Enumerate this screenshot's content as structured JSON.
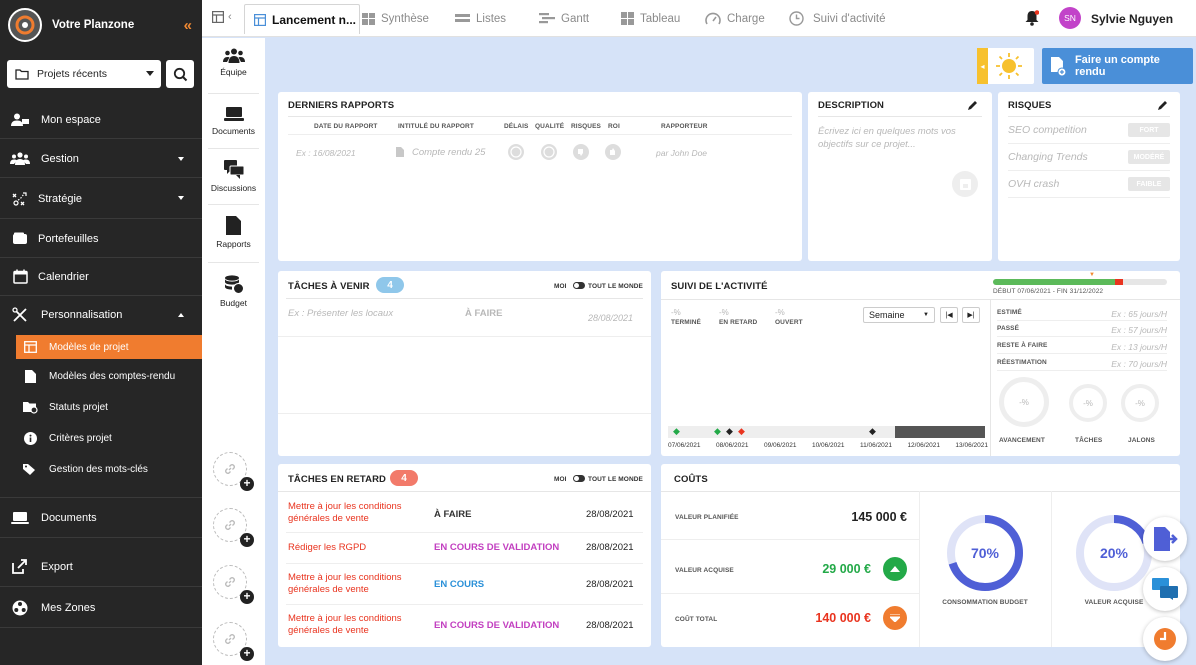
{
  "sidebar": {
    "app_title": "Votre Planzone",
    "project_selector": "Projets récents",
    "items": [
      {
        "label": "Mon espace",
        "icon": "users-icon"
      },
      {
        "label": "Gestion",
        "icon": "team-icon"
      },
      {
        "label": "Stratégie",
        "icon": "strategy-icon"
      },
      {
        "label": "Portefeuilles",
        "icon": "wallet-icon"
      },
      {
        "label": "Calendrier",
        "icon": "calendar-icon"
      },
      {
        "label": "Personnalisation",
        "icon": "tools-icon"
      },
      {
        "label": "Documents",
        "icon": "laptop-icon"
      },
      {
        "label": "Export",
        "icon": "export-icon"
      },
      {
        "label": "Mes Zones",
        "icon": "zones-icon"
      }
    ],
    "sub_items": [
      {
        "label": "Modèles de projet"
      },
      {
        "label": "Modèles des comptes-rendu"
      },
      {
        "label": "Statuts projet"
      },
      {
        "label": "Critères projet"
      },
      {
        "label": "Gestion des mots-clés"
      }
    ]
  },
  "topbar": {
    "active_tab": "Lancement n...",
    "tabs": [
      "Synthèse",
      "Listes",
      "Gantt",
      "Tableau",
      "Charge",
      "Suivi d'activité"
    ],
    "user_initials": "SN",
    "user_name": "Sylvie Nguyen"
  },
  "rail": {
    "items": [
      "Équipe",
      "Documents",
      "Discussions",
      "Rapports",
      "Budget"
    ]
  },
  "report_button": "Faire un compte rendu",
  "reports": {
    "title": "DERNIERS RAPPORTS",
    "columns": [
      "DATE DU RAPPORT",
      "INTITULÉ DU RAPPORT",
      "DÉLAIS",
      "QUALITÉ",
      "RISQUES",
      "ROI",
      "RAPPORTEUR"
    ],
    "example_date": "Ex : 16/08/2021",
    "example_title": "Compte rendu 25",
    "example_author": "par John Doe"
  },
  "description": {
    "title": "DESCRIPTION",
    "placeholder": "Écrivez ici en quelques mots vos objectifs sur ce projet..."
  },
  "risks": {
    "title": "RISQUES",
    "items": [
      {
        "name": "SEO competition",
        "level": "FORT"
      },
      {
        "name": "Changing Trends",
        "level": "MODÉRÉ"
      },
      {
        "name": "OVH crash",
        "level": "FAIBLE"
      }
    ]
  },
  "upcoming": {
    "title": "TÂCHES À VENIR",
    "count": "4",
    "toggle_me": "MOI",
    "toggle_all": "TOUT LE MONDE",
    "example_task": "Ex : Présenter les locaux",
    "example_status": "À FAIRE",
    "example_date": "28/08/2021"
  },
  "activity": {
    "title": "SUIVI DE L'ACTIVITÉ",
    "date_range": "DÉBUT 07/06/2021 - FIN 31/12/2022",
    "progress_green": 0.7,
    "progress_red": 0.05,
    "stats": [
      {
        "value": "-%",
        "label": "TERMINÉ"
      },
      {
        "value": "-%",
        "label": "EN RETARD"
      },
      {
        "value": "-%",
        "label": "OUVERT"
      }
    ],
    "period": "Semaine",
    "timeline_dates": [
      "07/06/2021",
      "08/06/2021",
      "09/06/2021",
      "10/06/2021",
      "11/06/2021",
      "12/06/2021",
      "13/06/2021"
    ],
    "metrics": [
      {
        "label": "ESTIMÉ",
        "value": "Ex : 65 jours/H"
      },
      {
        "label": "PASSÉ",
        "value": "Ex : 57 jours/H"
      },
      {
        "label": "RESTE À FAIRE",
        "value": "Ex : 13 jours/H"
      },
      {
        "label": "RÉESTIMATION",
        "value": "Ex : 70 jours/H"
      }
    ],
    "gauges": [
      {
        "value": "-%",
        "label": "AVANCEMENT"
      },
      {
        "value": "-%",
        "label": "TÂCHES"
      },
      {
        "value": "-%",
        "label": "JALONS"
      }
    ]
  },
  "late": {
    "title": "TÂCHES EN RETARD",
    "count": "4",
    "toggle_me": "MOI",
    "toggle_all": "TOUT LE MONDE",
    "rows": [
      {
        "task": "Mettre à jour les conditions générales de vente",
        "status": "À FAIRE",
        "status_color": "#333333",
        "date": "28/08/2021"
      },
      {
        "task": "Rédiger les RGPD",
        "status": "EN COURS DE VALIDATION",
        "status_color": "#c23fc0",
        "date": "28/08/2021"
      },
      {
        "task": "Mettre à jour les conditions générales de vente",
        "status": "EN COURS",
        "status_color": "#2a90d8",
        "date": "28/08/2021"
      },
      {
        "task": "Mettre à jour les conditions générales de vente",
        "status": "EN COURS DE VALIDATION",
        "status_color": "#c23fc0",
        "date": "28/08/2021"
      }
    ]
  },
  "costs": {
    "title": "COÛTS",
    "planned_label": "VALEUR PLANIFIÉE",
    "planned_value": "145 000 €",
    "acquired_label": "VALEUR ACQUISE",
    "acquired_value": "29 000 €",
    "total_label": "COÛT TOTAL",
    "total_value": "140 000 €",
    "budget_pct": "70%",
    "budget_fraction": 0.7,
    "budget_label": "CONSOMMATION BUDGET",
    "acquired_pct": "20%",
    "acquired_fraction": 0.2,
    "acquired_donut_label": "VALEUR ACQUISE"
  },
  "colors": {
    "accent": "#f07c2f",
    "primary_blue": "#4a8fd8",
    "donut": "#4f5fd6",
    "late_red": "#e9341f",
    "positive_green": "#23a948"
  }
}
